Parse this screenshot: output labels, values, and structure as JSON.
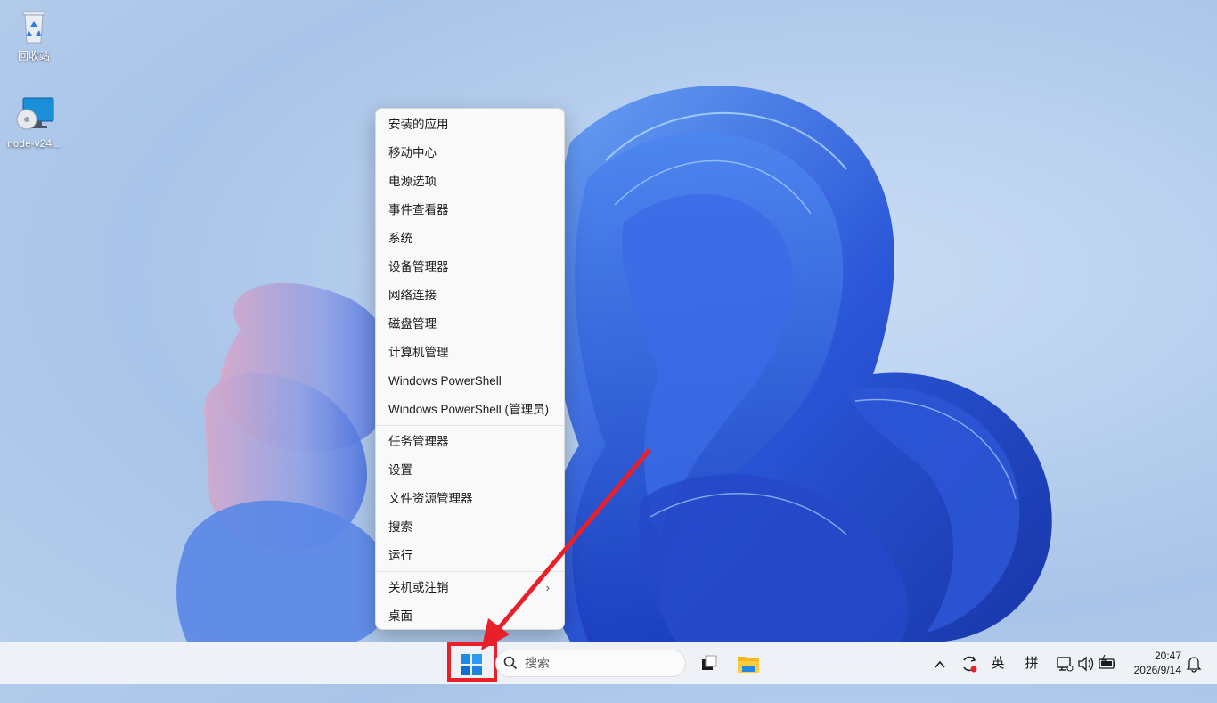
{
  "desktop": {
    "icons": [
      {
        "label": "回收站"
      },
      {
        "label": "node-v24..."
      }
    ]
  },
  "context_menu": {
    "groups": [
      [
        "安装的应用",
        "移动中心",
        "电源选项",
        "事件查看器",
        "系统",
        "设备管理器",
        "网络连接",
        "磁盘管理",
        "计算机管理",
        "Windows PowerShell",
        "Windows PowerShell (管理员)"
      ],
      [
        "任务管理器",
        "设置",
        "文件资源管理器",
        "搜索",
        "运行"
      ],
      [
        "关机或注销",
        "桌面"
      ]
    ],
    "submenu_item": "关机或注销"
  },
  "taskbar": {
    "search_placeholder": "搜索",
    "tray": {
      "chevron": "^",
      "lang": "英",
      "ime": "拼"
    },
    "clock": {
      "time": "20:47",
      "date": "2026/9/14"
    }
  },
  "colors": {
    "highlight": "#e8202a",
    "windows_blue": "#0078d4"
  }
}
